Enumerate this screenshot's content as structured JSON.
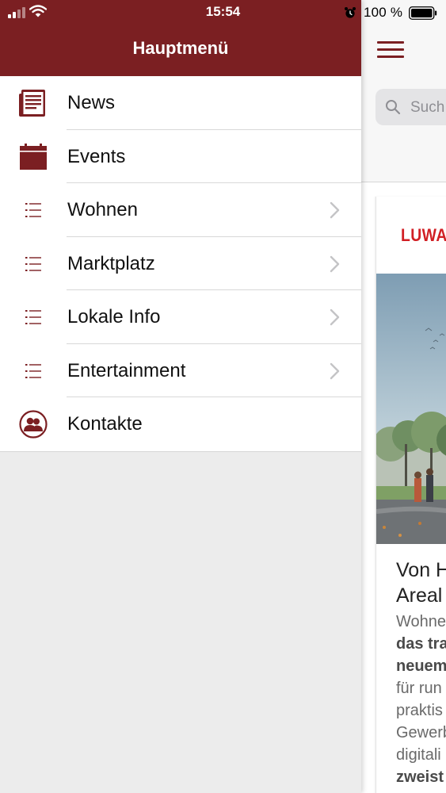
{
  "status_bar": {
    "time": "15:54",
    "battery_text": "100 %"
  },
  "drawer": {
    "title": "Hauptmenü",
    "items": [
      {
        "label": "News",
        "icon": "newspaper-icon",
        "has_chevron": false
      },
      {
        "label": "Events",
        "icon": "calendar-icon",
        "has_chevron": false
      },
      {
        "label": "Wohnen",
        "icon": "list-icon",
        "has_chevron": true
      },
      {
        "label": "Marktplatz",
        "icon": "list-icon",
        "has_chevron": true
      },
      {
        "label": "Lokale Info",
        "icon": "list-icon",
        "has_chevron": true
      },
      {
        "label": "Entertainment",
        "icon": "list-icon",
        "has_chevron": true
      },
      {
        "label": "Kontakte",
        "icon": "contacts-icon",
        "has_chevron": false
      }
    ]
  },
  "main": {
    "search_placeholder": "Such",
    "card": {
      "logo": "LUWA",
      "title_lines": [
        "Von H",
        "Areal"
      ],
      "body_lines": [
        {
          "text": "Wohne",
          "bold": false
        },
        {
          "text": "das tra",
          "bold": true
        },
        {
          "text": "neuem",
          "bold": true
        },
        {
          "text": "für run",
          "bold": false
        },
        {
          "text": "praktis",
          "bold": false
        },
        {
          "text": "Gewerb",
          "bold": false
        },
        {
          "text": "digitali",
          "bold": false
        },
        {
          "text": "zweist",
          "bold": true
        }
      ]
    }
  },
  "colors": {
    "accent": "#7b1f22",
    "logo_red": "#d11f24",
    "drawer_bg": "#ececec"
  }
}
